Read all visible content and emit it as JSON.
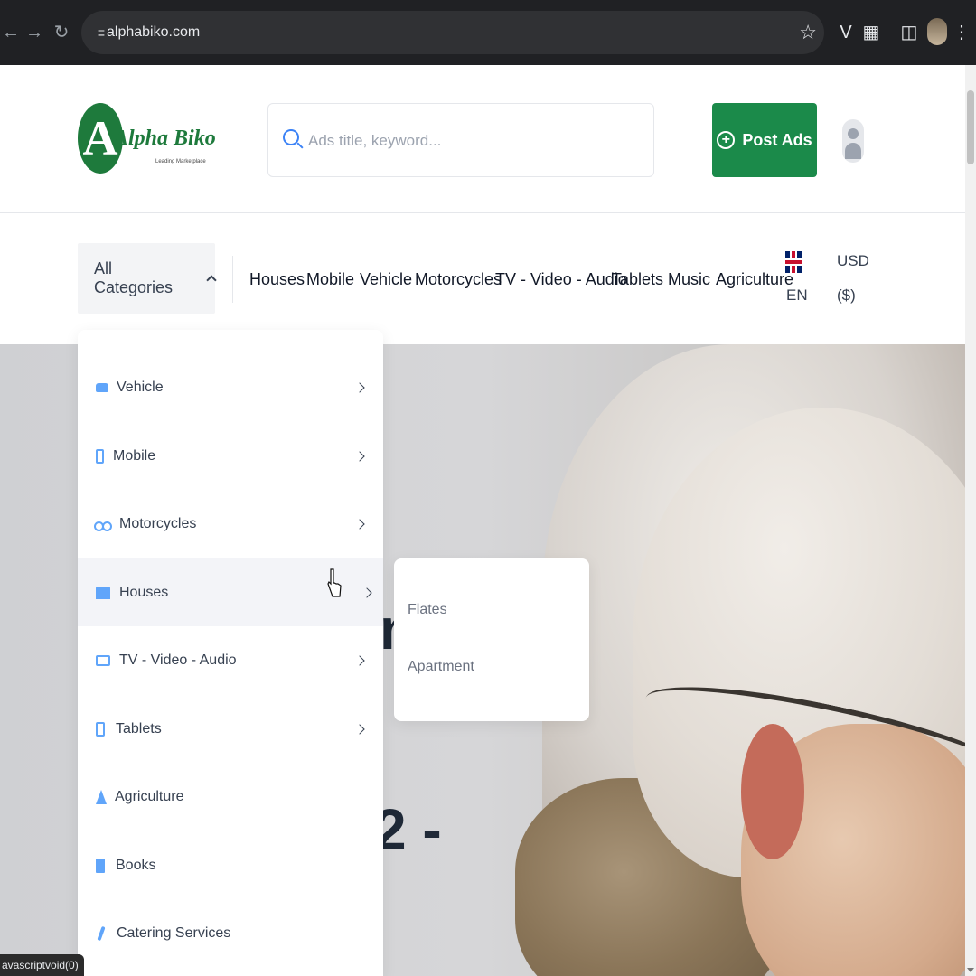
{
  "browser": {
    "url": "alphabiko.com"
  },
  "header": {
    "logo_name": "Alpha Biko",
    "logo_tagline": "Leading Marketplace",
    "search_placeholder": "Ads title, keyword...",
    "post_ads_label": "Post Ads",
    "brand_color": "#1b8a4a"
  },
  "nav": {
    "all_categories_label": "All Categories",
    "links": [
      "Houses",
      "Mobile",
      "Vehicle",
      "Motorcycles",
      "TV - Video - Audio",
      "Tablets",
      "Music",
      "Agriculture"
    ],
    "language": "EN",
    "currency_line1": "USD",
    "currency_line2": "($)"
  },
  "dropdown": {
    "items": [
      {
        "label": "Vehicle",
        "icon": "car-icon",
        "has_submenu": true
      },
      {
        "label": "Mobile",
        "icon": "phone-icon",
        "has_submenu": true
      },
      {
        "label": "Motorcycles",
        "icon": "motorcycle-icon",
        "has_submenu": true
      },
      {
        "label": "Houses",
        "icon": "house-icon",
        "has_submenu": true,
        "active": true
      },
      {
        "label": "TV - Video - Audio",
        "icon": "tv-icon",
        "has_submenu": true
      },
      {
        "label": "Tablets",
        "icon": "tablet-icon",
        "has_submenu": true
      },
      {
        "label": "Agriculture",
        "icon": "tree-icon",
        "has_submenu": false
      },
      {
        "label": "Books",
        "icon": "book-icon",
        "has_submenu": false
      },
      {
        "label": "Catering Services",
        "icon": "brush-icon",
        "has_submenu": false
      }
    ],
    "icon_color": "#60a5fa"
  },
  "submenu": {
    "items": [
      "Flates",
      "Apartment"
    ]
  },
  "hero": {
    "partial_text_1": "n",
    "partial_text_2": "2 -"
  },
  "status_bar": {
    "text": "avascriptvoid(0)"
  }
}
